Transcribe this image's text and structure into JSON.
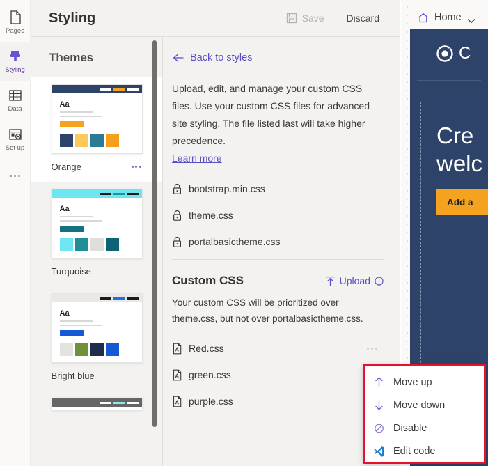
{
  "rail": {
    "items": [
      {
        "label": "Pages",
        "icon": "page-icon",
        "active": false
      },
      {
        "label": "Styling",
        "icon": "brush-icon",
        "active": true
      },
      {
        "label": "Data",
        "icon": "table-icon",
        "active": false
      },
      {
        "label": "Set up",
        "icon": "setup-icon",
        "active": false
      }
    ],
    "overflow_icon": "ellipsis-icon"
  },
  "header": {
    "title": "Styling",
    "save_label": "Save",
    "save_icon": "save-disk-icon",
    "save_disabled": true,
    "discard_label": "Discard"
  },
  "themes": {
    "title": "Themes",
    "items": [
      {
        "name": "Orange",
        "selected": true,
        "bar_color": "#2e4369",
        "navlinks": [
          "#ffffff",
          "#f5a21e",
          "#ffffff"
        ],
        "chip_color": "#f5a21e",
        "swatches": [
          "#2e4369",
          "#fcc95a",
          "#2a7b94",
          "#f79e1b"
        ]
      },
      {
        "name": "Turquoise",
        "selected": false,
        "bar_color": "#6ee6f2",
        "navlinks": [
          "#1a1a1a",
          "#1896a8",
          "#1a1a1a"
        ],
        "chip_color": "#15707f",
        "swatches": [
          "#6ee6f2",
          "#1f8f95",
          "#dededd",
          "#0d6274"
        ]
      },
      {
        "name": "Bright blue",
        "selected": false,
        "bar_color": "#e9e8e4",
        "navlinks": [
          "#1a1a1a",
          "#1f6fe0",
          "#1a1a1a"
        ],
        "chip_color": "#1559d6",
        "swatches": [
          "#e4e3dd",
          "#6d9239",
          "#1f2c4a",
          "#1559d6"
        ]
      },
      {
        "name": "",
        "selected": false,
        "bar_color": "#666666",
        "navlinks": [
          "#ffffff",
          "#8ee6f0",
          "#ffffff"
        ],
        "chip_color": "#666666",
        "swatches": []
      }
    ]
  },
  "details": {
    "back_label": "Back to styles",
    "back_icon": "arrow-left-icon",
    "intro": "Upload, edit, and manage your custom CSS files. Use your custom CSS files for advanced site styling. The file listed last will take higher precedence.",
    "learn_more": "Learn more",
    "system_files": [
      {
        "name": "bootstrap.min.css",
        "icon": "lock-icon"
      },
      {
        "name": "theme.css",
        "icon": "lock-icon"
      },
      {
        "name": "portalbasictheme.css",
        "icon": "lock-icon"
      }
    ],
    "custom_title": "Custom CSS",
    "upload_label": "Upload",
    "upload_icon": "upload-icon",
    "info_icon": "info-circle-icon",
    "custom_desc": "Your custom CSS will be prioritized over theme.css, but not over portalbasictheme.css.",
    "custom_files": [
      {
        "name": "Red.css",
        "icon": "css-file-icon",
        "menu_icon": "ellipsis-icon"
      },
      {
        "name": "green.css",
        "icon": "css-file-icon",
        "menu_icon": "ellipsis-icon"
      },
      {
        "name": "purple.css",
        "icon": "css-file-icon",
        "menu_icon": "ellipsis-icon"
      }
    ]
  },
  "context_menu": {
    "border_color": "#e8112d",
    "items": [
      {
        "label": "Move up",
        "icon": "arrow-up-icon"
      },
      {
        "label": "Move down",
        "icon": "arrow-down-icon"
      },
      {
        "label": "Disable",
        "icon": "block-icon"
      },
      {
        "label": "Edit code",
        "icon": "vscode-icon"
      }
    ]
  },
  "preview": {
    "home_label": "Home",
    "home_icon": "home-icon",
    "chevron_icon": "chevron-down-icon",
    "site_brand": "C",
    "logo_icon": "circle-logo-icon",
    "hero_line1": "Cre",
    "hero_line2": "welc",
    "hero_button": "Add a",
    "canvas_color": "#2e4369",
    "accent_color": "#f5a21e"
  }
}
